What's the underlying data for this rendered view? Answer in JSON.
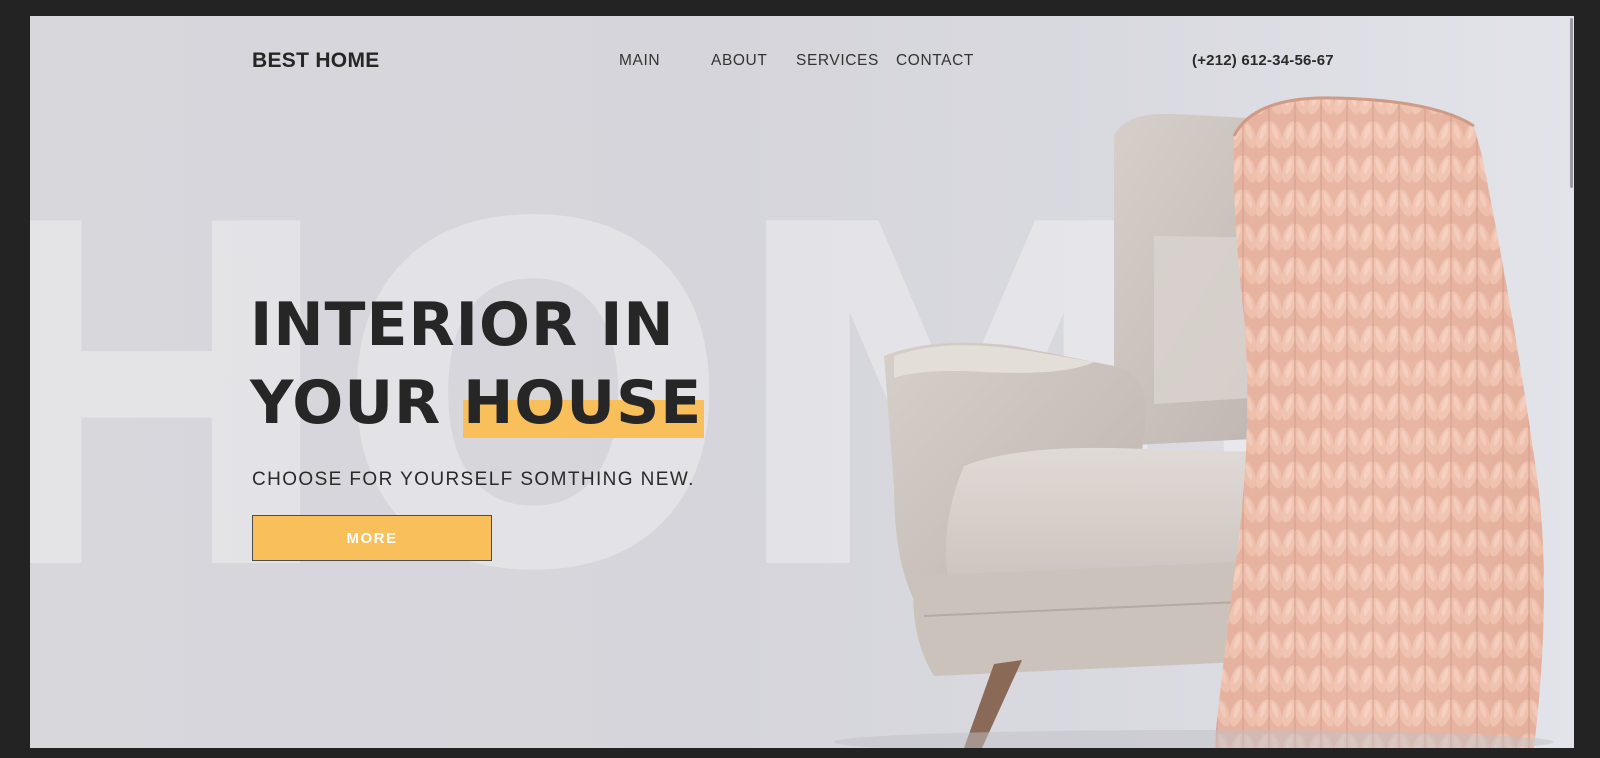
{
  "header": {
    "logo": "BEST HOME",
    "nav": [
      {
        "label": "MAIN"
      },
      {
        "label": "ABOUT"
      },
      {
        "label": "SERVICES"
      },
      {
        "label": "CONTACT"
      }
    ],
    "phone": "(+212) 612-34-56-67"
  },
  "hero": {
    "watermark": "HOME",
    "title_line1": "INTERIOR IN",
    "title_line2_plain": "YOUR ",
    "title_line2_highlight": "HOUSE",
    "subtitle": "CHOOSE FOR YOURSELF SOMTHING NEW.",
    "button_label": "MORE"
  },
  "colors": {
    "accent": "#f8bf5a",
    "text": "#262626",
    "background": "#d7d7dc",
    "frame": "#232323"
  },
  "icons": {
    "hero_image": "armchair-with-knit-blanket"
  }
}
